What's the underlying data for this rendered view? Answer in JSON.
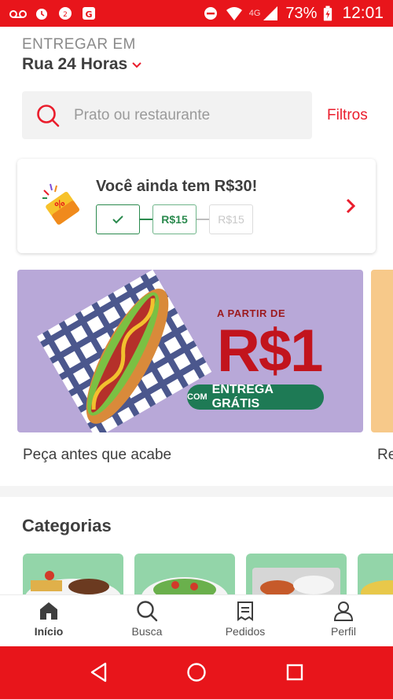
{
  "status_bar": {
    "network": "4G",
    "battery": "73%",
    "time": "12:01",
    "icons": [
      "voicemail-icon",
      "alarm-icon",
      "notification-badge-icon",
      "google-play-icon",
      "dnd-icon",
      "wifi-icon",
      "signal-icon",
      "battery-icon"
    ]
  },
  "address": {
    "label": "ENTREGAR EM",
    "value": "Rua 24 Horas"
  },
  "search": {
    "placeholder": "Prato ou restaurante",
    "filters_label": "Filtros"
  },
  "promo": {
    "title": "Você ainda tem R$30!",
    "steps": [
      "",
      "R$15",
      "R$15"
    ]
  },
  "banner": {
    "small_text": "A PARTIR DE",
    "big_text": "R$1",
    "pill_prefix": "COM",
    "pill_text": "ENTREGA GRÁTIS",
    "caption": "Peça antes que acabe",
    "next_caption": "Re"
  },
  "categories": {
    "title": "Categorias"
  },
  "bottom_nav": {
    "items": [
      {
        "label": "Início",
        "icon": "home-icon"
      },
      {
        "label": "Busca",
        "icon": "search-icon"
      },
      {
        "label": "Pedidos",
        "icon": "orders-icon"
      },
      {
        "label": "Perfil",
        "icon": "profile-icon"
      }
    ]
  },
  "colors": {
    "brand_red": "#ea1d2c",
    "status_red": "#e8151b",
    "success_green": "#2b8a4e",
    "banner_purple": "#b8a8d8"
  }
}
